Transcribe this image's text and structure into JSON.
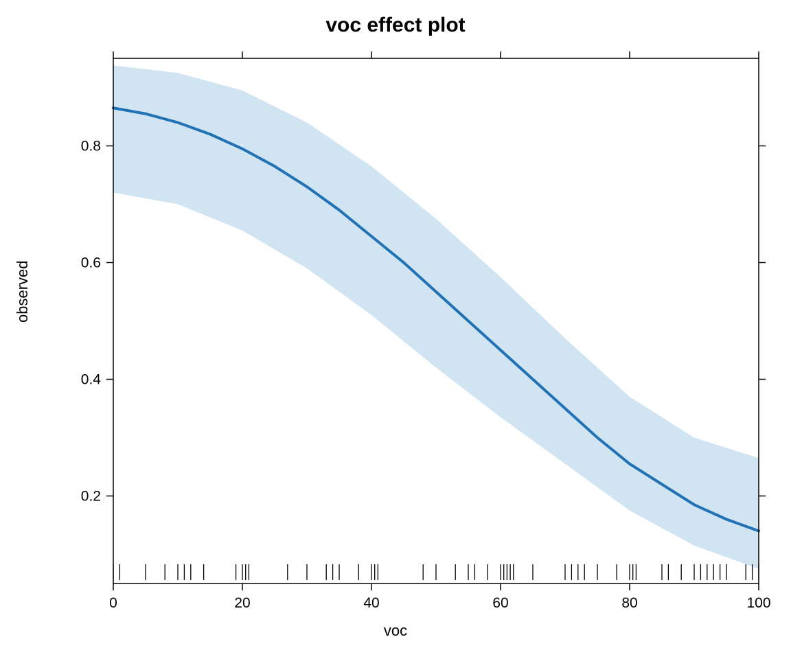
{
  "chart_data": {
    "type": "line",
    "title": "voc effect plot",
    "xlabel": "voc",
    "ylabel": "observed",
    "xlim": [
      0,
      100
    ],
    "ylim": [
      0.05,
      0.95
    ],
    "x_ticks": [
      0,
      20,
      40,
      60,
      80,
      100
    ],
    "y_ticks": [
      0.2,
      0.4,
      0.6,
      0.8
    ],
    "series": [
      {
        "name": "fit",
        "x": [
          0,
          5,
          10,
          15,
          20,
          25,
          30,
          35,
          40,
          45,
          50,
          55,
          60,
          65,
          70,
          75,
          80,
          85,
          90,
          95,
          100
        ],
        "y": [
          0.865,
          0.855,
          0.84,
          0.82,
          0.795,
          0.765,
          0.73,
          0.69,
          0.645,
          0.6,
          0.55,
          0.5,
          0.45,
          0.4,
          0.35,
          0.3,
          0.255,
          0.22,
          0.185,
          0.16,
          0.14
        ]
      },
      {
        "name": "upper",
        "x": [
          0,
          10,
          20,
          30,
          40,
          50,
          60,
          70,
          80,
          90,
          100
        ],
        "y": [
          0.938,
          0.925,
          0.895,
          0.84,
          0.765,
          0.675,
          0.575,
          0.47,
          0.37,
          0.3,
          0.265
        ]
      },
      {
        "name": "lower",
        "x": [
          0,
          10,
          20,
          30,
          40,
          50,
          60,
          70,
          80,
          90,
          100
        ],
        "y": [
          0.72,
          0.7,
          0.655,
          0.59,
          0.51,
          0.42,
          0.335,
          0.255,
          0.175,
          0.115,
          0.075
        ]
      }
    ],
    "rug_x": [
      0,
      1,
      5,
      8,
      10,
      11,
      12,
      14,
      19,
      20,
      20.5,
      21,
      27,
      30,
      33,
      34,
      35,
      38,
      40,
      40.5,
      41,
      48,
      50,
      53,
      55,
      56,
      58,
      60,
      60.5,
      61,
      61.5,
      62,
      65,
      70,
      71,
      72,
      73,
      75,
      78,
      80,
      80.5,
      81,
      85,
      86,
      88,
      90,
      91,
      92,
      93,
      94,
      95,
      98,
      99,
      100
    ],
    "colors": {
      "line": "#2171b5",
      "band": "#d0e4f2"
    }
  }
}
